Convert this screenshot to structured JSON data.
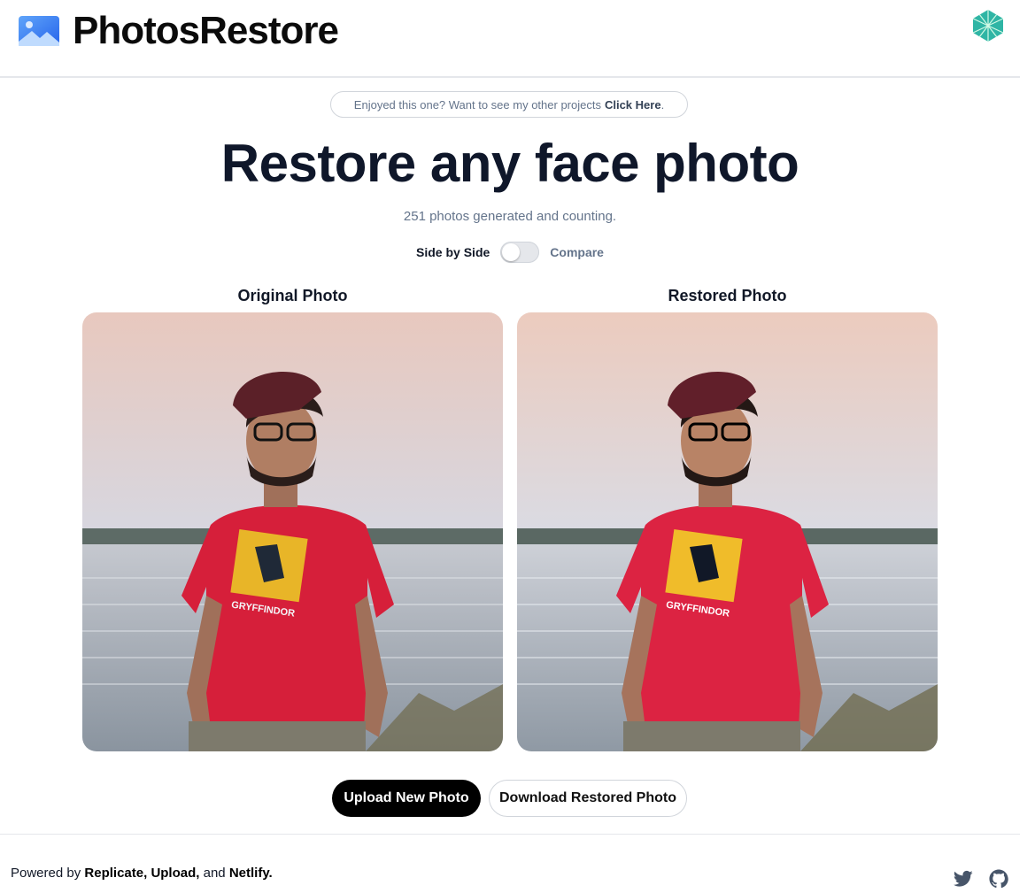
{
  "header": {
    "brand": "PhotosRestore",
    "logo_icon": "image-icon",
    "deploy_icon": "netlify-icon"
  },
  "promo": {
    "text": "Enjoyed this one? Want to see my other projects",
    "link": "Click Here",
    "suffix": "."
  },
  "hero": {
    "title": "Restore any face photo",
    "subtitle": "251 photos generated and counting."
  },
  "view_toggle": {
    "left_label": "Side by Side",
    "right_label": "Compare",
    "state": "side-by-side"
  },
  "panels": {
    "original_label": "Original Photo",
    "restored_label": "Restored Photo",
    "shirt_text": "GRYFFINDOR"
  },
  "actions": {
    "upload": "Upload New Photo",
    "download": "Download Restored Photo"
  },
  "footer": {
    "prefix": "Powered by",
    "link1": "Replicate,",
    "link2": "Upload,",
    "conj": "and",
    "link3": "Netlify.",
    "icons": [
      "twitter-icon",
      "github-icon"
    ]
  },
  "colors": {
    "brand_blue": "#3b82f6",
    "netlify_teal": "#2fb5a5",
    "primary_button": "#000000",
    "shirt_red": "#d61f3a"
  }
}
